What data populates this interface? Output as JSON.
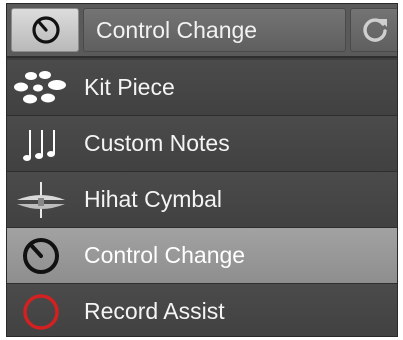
{
  "header": {
    "mode_icon": "dial-icon",
    "title": "Control Change",
    "refresh_icon": "refresh-icon"
  },
  "menu": {
    "selected_index": 3,
    "items": [
      {
        "label": "Kit Piece",
        "icon": "drum-kit-icon"
      },
      {
        "label": "Custom Notes",
        "icon": "music-notes-icon"
      },
      {
        "label": "Hihat Cymbal",
        "icon": "hihat-cymbal-icon"
      },
      {
        "label": "Control Change",
        "icon": "dial-icon"
      },
      {
        "label": "Record Assist",
        "icon": "red-circle-icon"
      }
    ]
  },
  "colors": {
    "selected_row": "#9a9a9a",
    "record_circle": "#d42020"
  }
}
